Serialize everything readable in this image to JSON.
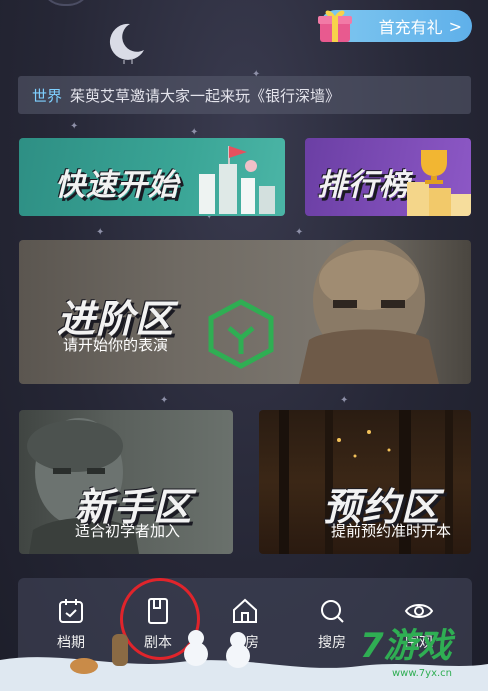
{
  "promo": {
    "label": "首充有礼",
    "arrow": ">",
    "icon": "gift-box-icon"
  },
  "banner": {
    "channel": "世界",
    "message": "茱萸艾草邀请大家一起来玩《银行深墙》"
  },
  "cards": {
    "quick": {
      "title": "快速开始"
    },
    "rank": {
      "title": "排行榜"
    },
    "advanced": {
      "title": "进阶区",
      "subtitle": "请开始你的表演"
    },
    "newbie": {
      "title": "新手区",
      "subtitle": "适合初学者加入"
    },
    "reserve": {
      "title": "预约区",
      "subtitle": "提前预约准时开本"
    }
  },
  "nav": {
    "items": [
      {
        "label": "档期",
        "icon": "calendar-icon"
      },
      {
        "label": "剧本",
        "icon": "script-book-icon"
      },
      {
        "label": "车房",
        "icon": "home-icon"
      },
      {
        "label": "搜房",
        "icon": "search-icon"
      },
      {
        "label": "围观",
        "icon": "eye-icon"
      }
    ]
  },
  "watermark": {
    "text": "7游戏",
    "url": "www.7yx.cn"
  },
  "colors": {
    "accent_teal": "#3aa596",
    "accent_purple": "#8d58c6",
    "promo_blue": "#5fb0ea",
    "highlight_red": "#e0242b",
    "watermark_green": "#2fae53"
  }
}
